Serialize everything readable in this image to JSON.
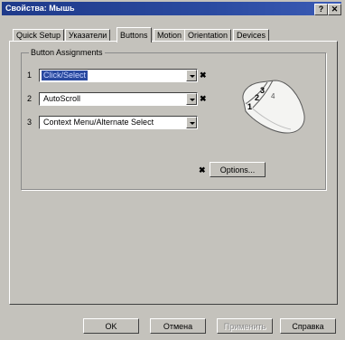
{
  "window": {
    "title": "Свойства: Мышь",
    "help_btn": "?",
    "close_btn": "✕"
  },
  "tabs": [
    {
      "label": "Quick Setup"
    },
    {
      "label": "Указатели"
    },
    {
      "label": "Buttons"
    },
    {
      "label": "Motion"
    },
    {
      "label": "Orientation"
    },
    {
      "label": "Devices"
    }
  ],
  "active_tab": "Buttons",
  "group": {
    "title": "Button Assignments"
  },
  "assignments": [
    {
      "num": "1",
      "value": "Click/Select",
      "selected": true,
      "mark": "✖"
    },
    {
      "num": "2",
      "value": "AutoScroll",
      "selected": false,
      "mark": "✖"
    },
    {
      "num": "3",
      "value": "Context Menu/Alternate Select",
      "selected": false,
      "mark": ""
    }
  ],
  "options": {
    "mark": "✖",
    "label": "Options..."
  },
  "mouse_labels": [
    "1",
    "2",
    "3",
    "4"
  ],
  "footer": {
    "ok": "OK",
    "cancel": "Отмена",
    "apply": "Применить",
    "help": "Справка"
  },
  "colors": {
    "title_bar": "#1f3a8a",
    "selection": "#2a4aa0",
    "face": "#c4c2bc"
  }
}
